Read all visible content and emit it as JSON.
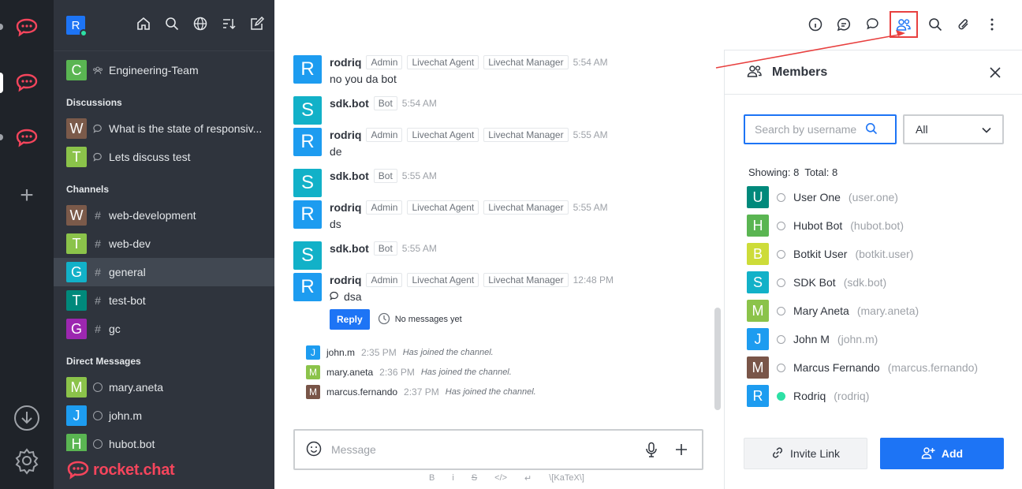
{
  "sidebar": {
    "user_initial": "R",
    "items_top": [
      {
        "initial": "C",
        "color": "#5ab552",
        "label": "Engineering-Team",
        "kind": "team"
      }
    ],
    "sections": {
      "discussions": "Discussions",
      "channels": "Channels",
      "direct": "Direct Messages"
    },
    "discussions": [
      {
        "initial": "W",
        "color": "#7b5a4a",
        "label": "What is the state of responsiv..."
      },
      {
        "initial": "T",
        "color": "#8bc34a",
        "label": "Lets discuss test"
      }
    ],
    "channels": [
      {
        "initial": "W",
        "color": "#7b5a4a",
        "label": "web-development"
      },
      {
        "initial": "T",
        "color": "#8bc34a",
        "label": "web-dev"
      },
      {
        "initial": "G",
        "color": "#12b1c8",
        "label": "general"
      },
      {
        "initial": "T",
        "color": "#00897b",
        "label": "test-bot"
      },
      {
        "initial": "G",
        "color": "#9c27b0",
        "label": "gc"
      }
    ],
    "direct": [
      {
        "initial": "M",
        "color": "#8bc34a",
        "label": "mary.aneta"
      },
      {
        "initial": "J",
        "color": "#1d9cf0",
        "label": "john.m"
      },
      {
        "initial": "H",
        "color": "#5ab552",
        "label": "hubot.bot"
      }
    ],
    "brand": "rocket.chat"
  },
  "room": {
    "initial": "G",
    "name": "general"
  },
  "messages": [
    {
      "initial": "R",
      "color": "#1d9cf0",
      "name": "rodriq",
      "roles": [
        "Admin",
        "Livechat Agent",
        "Livechat Manager"
      ],
      "time": "5:54 AM",
      "text": "no you da bot"
    },
    {
      "initial": "S",
      "color": "#12b1c8",
      "name": "sdk.bot",
      "roles": [
        "Bot"
      ],
      "time": "5:54 AM",
      "text": ""
    },
    {
      "initial": "R",
      "color": "#1d9cf0",
      "name": "rodriq",
      "roles": [
        "Admin",
        "Livechat Agent",
        "Livechat Manager"
      ],
      "time": "5:55 AM",
      "text": "de"
    },
    {
      "initial": "S",
      "color": "#12b1c8",
      "name": "sdk.bot",
      "roles": [
        "Bot"
      ],
      "time": "5:55 AM",
      "text": ""
    },
    {
      "initial": "R",
      "color": "#1d9cf0",
      "name": "rodriq",
      "roles": [
        "Admin",
        "Livechat Agent",
        "Livechat Manager"
      ],
      "time": "5:55 AM",
      "text": "ds"
    },
    {
      "initial": "S",
      "color": "#12b1c8",
      "name": "sdk.bot",
      "roles": [
        "Bot"
      ],
      "time": "5:55 AM",
      "text": ""
    },
    {
      "initial": "R",
      "color": "#1d9cf0",
      "name": "rodriq",
      "roles": [
        "Admin",
        "Livechat Agent",
        "Livechat Manager"
      ],
      "time": "12:48 PM",
      "text": "dsa",
      "thread": true
    }
  ],
  "thread": {
    "reply_label": "Reply",
    "no_messages": "No messages yet"
  },
  "system": [
    {
      "initial": "J",
      "color": "#1d9cf0",
      "name": "john.m",
      "time": "2:35 PM",
      "text": "Has joined the channel."
    },
    {
      "initial": "M",
      "color": "#8bc34a",
      "name": "mary.aneta",
      "time": "2:36 PM",
      "text": "Has joined the channel."
    },
    {
      "initial": "M",
      "color": "#795548",
      "name": "marcus.fernando",
      "time": "2:37 PM",
      "text": "Has joined the channel."
    }
  ],
  "composer": {
    "placeholder": "Message",
    "format": [
      "B",
      "i",
      "S",
      "</>",
      "↵",
      "\\[KaTeX\\]"
    ]
  },
  "members": {
    "title": "Members",
    "search_placeholder": "Search by username",
    "filter_value": "All",
    "showing_label": "Showing: 8",
    "total_label": "Total: 8",
    "list": [
      {
        "initial": "U",
        "color": "#00897b",
        "name": "User One",
        "username": "(user.one)",
        "online": false
      },
      {
        "initial": "H",
        "color": "#5ab552",
        "name": "Hubot Bot",
        "username": "(hubot.bot)",
        "online": false
      },
      {
        "initial": "B",
        "color": "#cddc39",
        "name": "Botkit User",
        "username": "(botkit.user)",
        "online": false
      },
      {
        "initial": "S",
        "color": "#12b1c8",
        "name": "SDK Bot",
        "username": "(sdk.bot)",
        "online": false
      },
      {
        "initial": "M",
        "color": "#8bc34a",
        "name": "Mary Aneta",
        "username": "(mary.aneta)",
        "online": false
      },
      {
        "initial": "J",
        "color": "#1d9cf0",
        "name": "John M",
        "username": "(john.m)",
        "online": false
      },
      {
        "initial": "M",
        "color": "#795548",
        "name": "Marcus Fernando",
        "username": "(marcus.fernando)",
        "online": false
      },
      {
        "initial": "R",
        "color": "#1d9cf0",
        "name": "Rodriq",
        "username": "(rodriq)",
        "online": true
      }
    ],
    "invite_label": "Invite Link",
    "add_label": "Add"
  },
  "colors": {
    "accent": "#1d74f5",
    "brand": "#f5455c",
    "annotation": "#e8403f"
  }
}
